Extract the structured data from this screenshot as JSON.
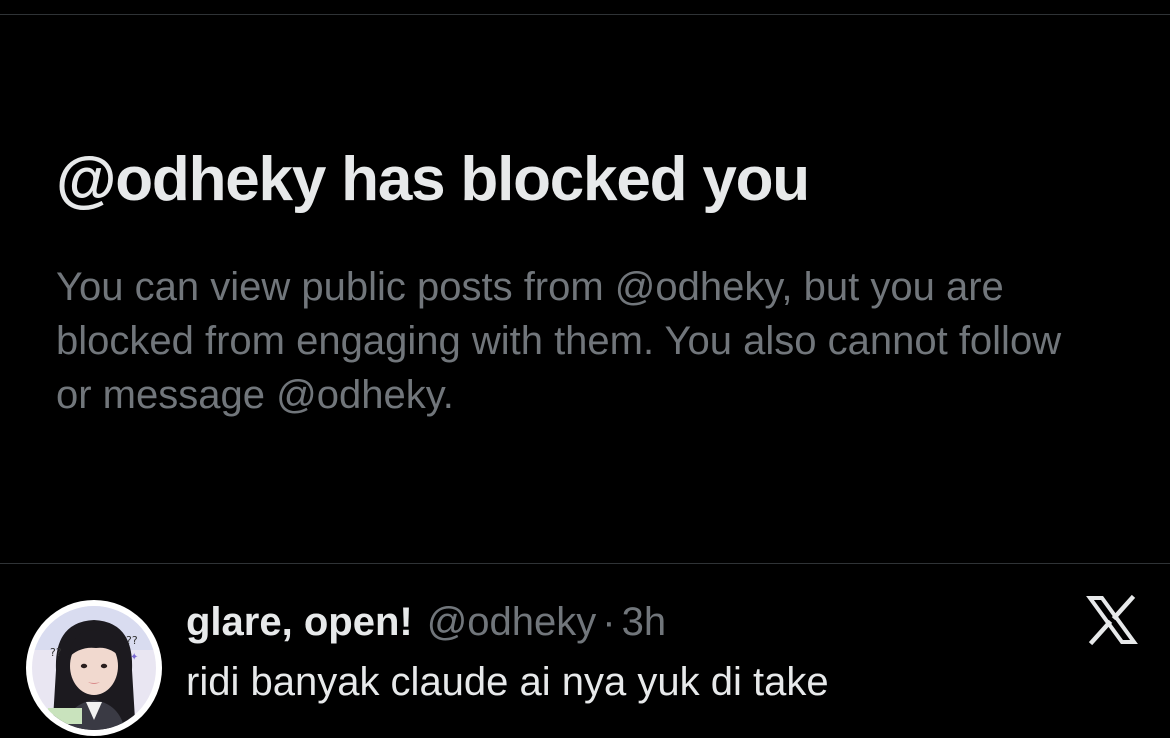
{
  "blocked_notice": {
    "title": "@odheky has blocked you",
    "body": "You can view public posts from @odheky, but you are blocked from engaging with them. You also cannot follow or message @odheky."
  },
  "post": {
    "display_name": "glare, open!",
    "handle": "@odheky",
    "separator": "·",
    "time": "3h",
    "text": "ridi banyak claude ai nya yuk di take",
    "avatar_icon": "profile-photo",
    "brand_icon": "x-logo-icon"
  },
  "colors": {
    "background": "#000000",
    "primary_text": "#e7e9ea",
    "secondary_text": "#71767b",
    "divider": "#2f3336"
  }
}
